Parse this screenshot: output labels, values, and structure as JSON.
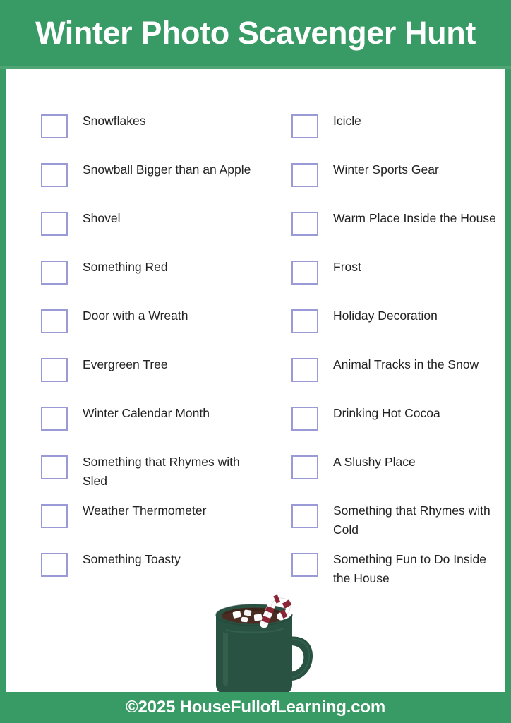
{
  "header": {
    "title": "Winter Photo Scavenger Hunt",
    "background_color": "#389a64",
    "text_color": "#ffffff"
  },
  "theme": {
    "green": "#389a64",
    "green_light": "#4fa674",
    "checkbox_border": "#9a9ad6",
    "text": "#222222",
    "mug_green": "#2a5242",
    "mug_green_dark": "#234438",
    "cocoa_brown": "#4a2c23",
    "candy_red": "#8b2636",
    "marshmallow_white": "#ffffff"
  },
  "checklist": {
    "left_column": [
      {
        "label": "Snowflakes",
        "checked": false
      },
      {
        "label": "Snowball Bigger than an Apple",
        "checked": false
      },
      {
        "label": "Shovel",
        "checked": false
      },
      {
        "label": "Something Red",
        "checked": false
      },
      {
        "label": "Door with a Wreath",
        "checked": false
      },
      {
        "label": "Evergreen Tree",
        "checked": false
      },
      {
        "label": "Winter Calendar Month",
        "checked": false
      },
      {
        "label": "Something that Rhymes with Sled",
        "checked": false
      },
      {
        "label": "Weather Thermometer",
        "checked": false
      },
      {
        "label": "Something Toasty",
        "checked": false
      }
    ],
    "right_column": [
      {
        "label": "Icicle",
        "checked": false
      },
      {
        "label": "Winter Sports Gear",
        "checked": false
      },
      {
        "label": "Warm Place Inside the House",
        "checked": false
      },
      {
        "label": "Frost",
        "checked": false
      },
      {
        "label": "Holiday Decoration",
        "checked": false
      },
      {
        "label": "Animal Tracks in the Snow",
        "checked": false
      },
      {
        "label": "Drinking Hot Cocoa",
        "checked": false
      },
      {
        "label": "A Slushy Place",
        "checked": false
      },
      {
        "label": "Something that Rhymes with Cold",
        "checked": false
      },
      {
        "label": "Something Fun to Do Inside the House",
        "checked": false
      }
    ]
  },
  "illustration": {
    "name": "hot-cocoa-mug-with-candy-cane"
  },
  "footer": {
    "text": "©2025 HouseFullofLearning.com"
  }
}
